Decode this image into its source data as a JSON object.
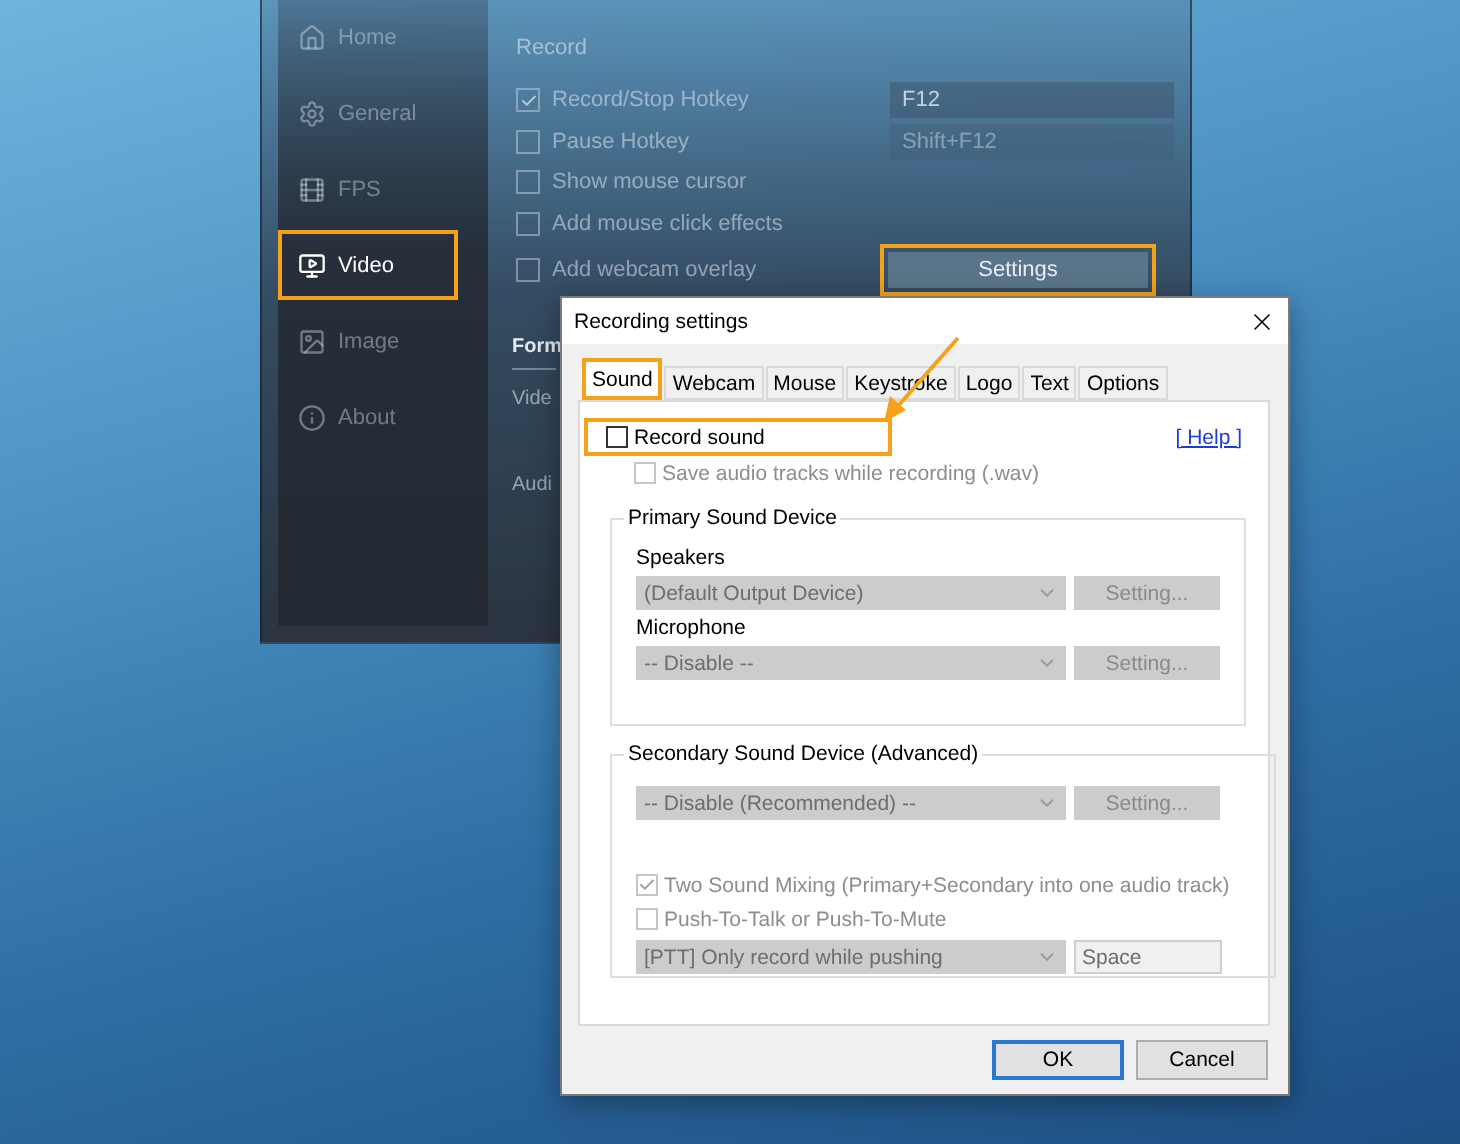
{
  "main_window": {
    "sidebar": [
      {
        "label": "Home",
        "selected": false,
        "highlighted": false
      },
      {
        "label": "General",
        "selected": false,
        "highlighted": false
      },
      {
        "label": "FPS",
        "selected": false,
        "highlighted": false
      },
      {
        "label": "Video",
        "selected": true,
        "highlighted": true
      },
      {
        "label": "Image",
        "selected": false,
        "highlighted": false
      },
      {
        "label": "About",
        "selected": false,
        "highlighted": false
      }
    ],
    "section_title": "Record",
    "options": [
      {
        "label": "Record/Stop Hotkey",
        "checked": true,
        "hotkey": {
          "value": "F12",
          "disabled": false
        }
      },
      {
        "label": "Pause Hotkey",
        "checked": false,
        "hotkey": {
          "value": "Shift+F12",
          "disabled": true
        }
      },
      {
        "label": "Show mouse cursor",
        "checked": false
      },
      {
        "label": "Add mouse click effects",
        "checked": false
      },
      {
        "label": "Add webcam overlay",
        "checked": false
      }
    ],
    "settings_button": {
      "label": "Settings",
      "highlighted": true
    },
    "format_heading": "Form",
    "video_label": "Vide",
    "audio_label": "Audi"
  },
  "dialog": {
    "title": "Recording settings",
    "tabs": [
      {
        "label": "Sound",
        "selected": true,
        "highlighted": true
      },
      {
        "label": "Webcam",
        "selected": false,
        "highlighted": false
      },
      {
        "label": "Mouse",
        "selected": false,
        "highlighted": false
      },
      {
        "label": "Keystroke",
        "selected": false,
        "highlighted": false
      },
      {
        "label": "Logo",
        "selected": false,
        "highlighted": false
      },
      {
        "label": "Text",
        "selected": false,
        "highlighted": false
      },
      {
        "label": "Options",
        "selected": false,
        "highlighted": false
      }
    ],
    "record_sound": {
      "label": "Record sound",
      "checked": false,
      "disabled": false,
      "highlighted": true
    },
    "help_link": "[ Help ]",
    "save_audio": {
      "label": "Save audio tracks while recording (.wav)",
      "checked": false,
      "disabled": true
    },
    "primary_group": {
      "title": "Primary Sound Device",
      "devices": [
        {
          "label": "Speakers",
          "combo": {
            "value": "(Default Output Device)",
            "disabled": true
          },
          "button": {
            "label": "Setting...",
            "disabled": true
          }
        },
        {
          "label": "Microphone",
          "combo": {
            "value": "-- Disable --",
            "disabled": true
          },
          "button": {
            "label": "Setting...",
            "disabled": true
          }
        }
      ]
    },
    "secondary_group": {
      "title": "Secondary Sound Device (Advanced)",
      "combo": {
        "value": "-- Disable (Recommended) --",
        "disabled": true
      },
      "button": {
        "label": "Setting...",
        "disabled": true
      },
      "mixing": {
        "label": "Two Sound Mixing (Primary+Secondary into one audio track)",
        "checked": true,
        "disabled": true
      },
      "ptt": {
        "label": "Push-To-Talk or Push-To-Mute",
        "checked": false,
        "disabled": true
      },
      "ptt_combo": {
        "value": "[PTT] Only record while pushing",
        "disabled": true
      },
      "ptt_key": {
        "value": "Space",
        "disabled": true
      }
    },
    "buttons": [
      {
        "label": "OK",
        "default": true
      },
      {
        "label": "Cancel",
        "default": false
      }
    ]
  }
}
